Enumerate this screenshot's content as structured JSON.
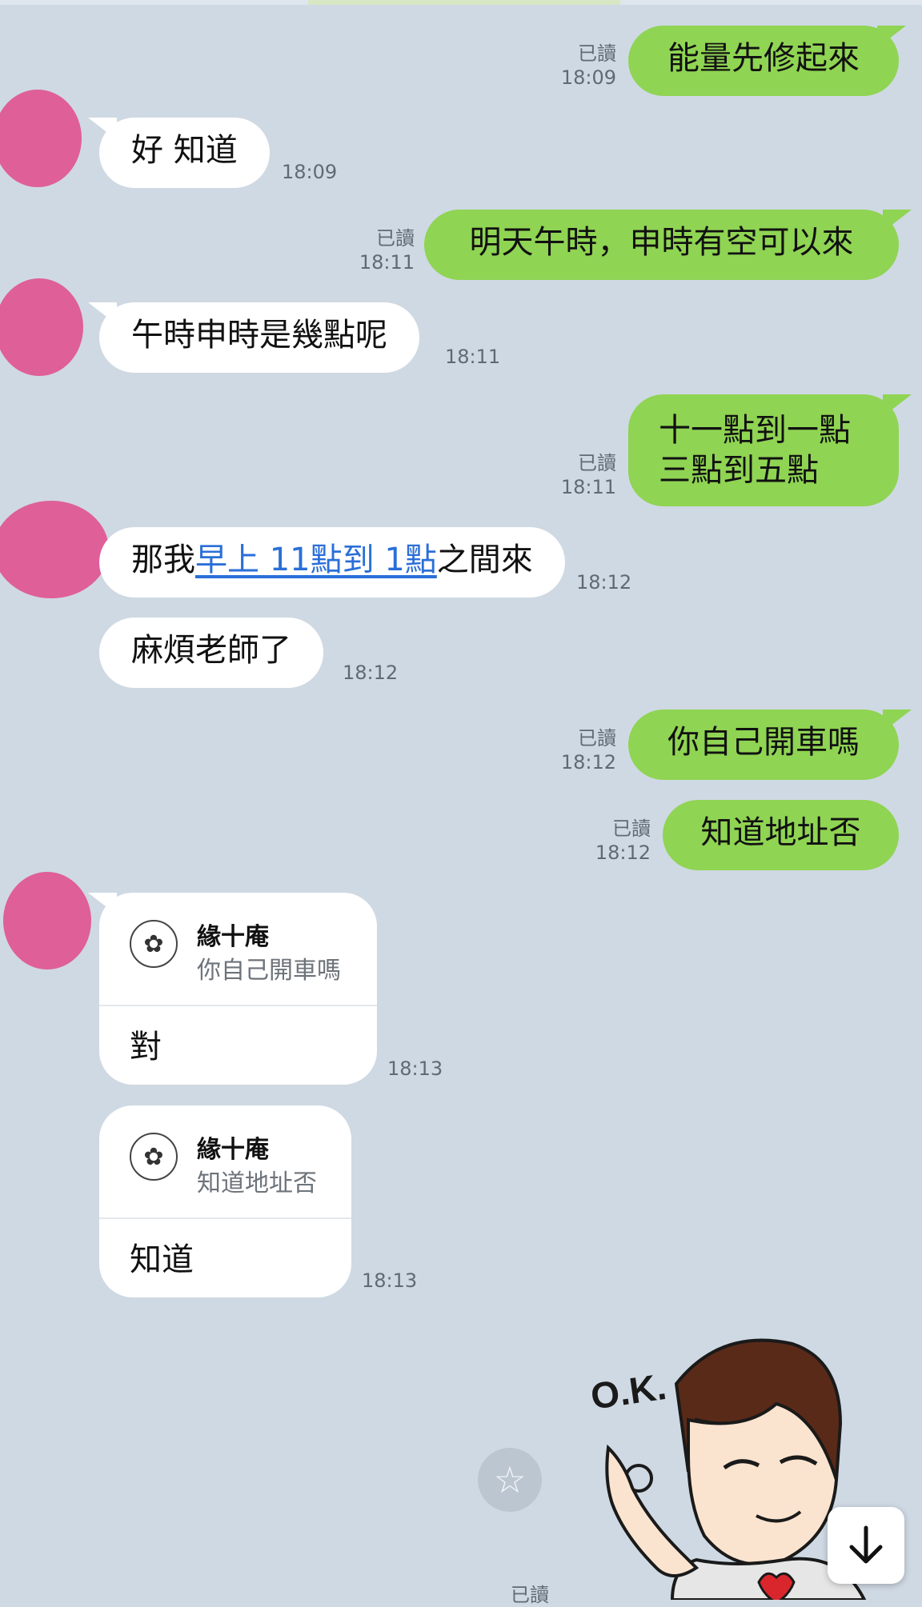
{
  "chat": {
    "read_label": "已讀",
    "messages": {
      "m1": {
        "text": "能量先修起來",
        "time": "18:09"
      },
      "m2": {
        "text": "好 知道",
        "time": "18:09"
      },
      "m3": {
        "text": "明天午時，申時有空可以來",
        "time": "18:11"
      },
      "m4": {
        "text": "午時申時是幾點呢",
        "time": "18:11"
      },
      "m5": {
        "line1": "十一點到一點",
        "line2": "三點到五點",
        "time": "18:11"
      },
      "m6": {
        "prefix": "那我",
        "link": "早上 11點到 1點",
        "suffix": "之間來",
        "time": "18:12"
      },
      "m7": {
        "text": "麻煩老師了",
        "time": "18:12"
      },
      "m8": {
        "text": "你自己開車嗎",
        "time": "18:12"
      },
      "m9": {
        "text": "知道地址否",
        "time": "18:12"
      },
      "m10": {
        "reply_name": "緣十庵",
        "reply_quote": "你自己開車嗎",
        "text": "對",
        "time": "18:13"
      },
      "m11": {
        "reply_name": "緣十庵",
        "reply_quote": "知道地址否",
        "text": "知道",
        "time": "18:13"
      }
    },
    "sticker_text": "O.K."
  },
  "icons": {
    "star": "star-icon",
    "down": "arrow-down-icon"
  },
  "colors": {
    "background": "#cfd9e3",
    "outgoing": "#8fd453",
    "incoming": "#ffffff",
    "avatar": "#df5f99",
    "link": "#2a6fd8"
  }
}
